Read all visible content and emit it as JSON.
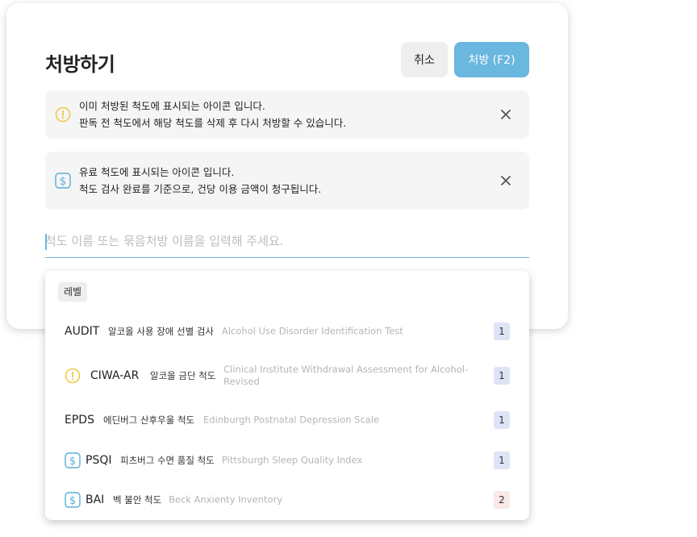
{
  "modal": {
    "title": "처방하기",
    "cancel_label": "취소",
    "prescribe_label": "처방 (F2)"
  },
  "notices": [
    {
      "icon": "warning-circle-icon",
      "line1": "이미 처방된 척도에 표시되는 아이콘 입니다.",
      "line2": "판독 전 척도에서 해당 척도를 삭제 후 다시 처방할 수 있습니다."
    },
    {
      "icon": "dollar-icon",
      "line1": "유료 척도에 표시되는 아이콘 입니다.",
      "line2": "척도 검사 완료를 기준으로, 건당 이용 금액이 청구됩니다."
    }
  ],
  "search": {
    "placeholder": "척도 이름 또는 묶음처방 이름을 입력해 주세요."
  },
  "dropdown": {
    "label": "레벨",
    "items": [
      {
        "abbr": "AUDIT",
        "korean": "알코올 사용 장애 선별 검사",
        "english": "Alcohol Use Disorder Identification Test",
        "level": "1",
        "icon": ""
      },
      {
        "abbr": "CIWA-AR",
        "korean": "알코올 금단 척도",
        "english": "Clinical Institute Withdrawal Assessment for Alcohol-Revised",
        "level": "1",
        "icon": "warning-circle-icon"
      },
      {
        "abbr": "EPDS",
        "korean": "에딘버그 산후우울 척도",
        "english": "Edinburgh Postnatal Depression Scale",
        "level": "1",
        "icon": ""
      },
      {
        "abbr": "PSQI",
        "korean": "피츠버그 수면 품질 척도",
        "english": "Pittsburgh Sleep Quality Index",
        "level": "1",
        "icon": "dollar-icon"
      },
      {
        "abbr": "BAI",
        "korean": "벡 불안 척도",
        "english": "Beck Anxienty Inventory",
        "level": "2",
        "icon": "dollar-icon"
      }
    ]
  },
  "colors": {
    "accent": "#6ab7df",
    "warning": "#f0c94a",
    "paid": "#5aaed6"
  }
}
